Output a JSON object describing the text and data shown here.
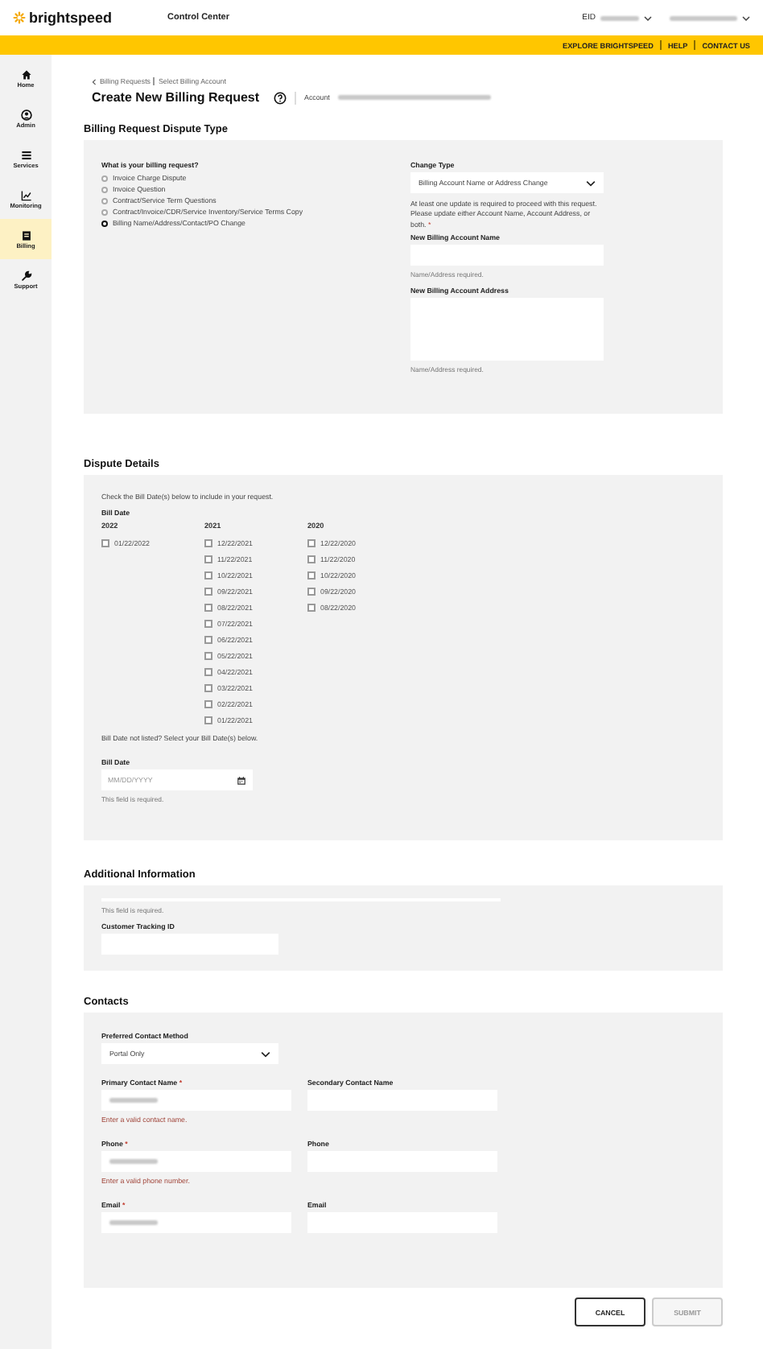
{
  "header": {
    "logo": "brightspeed",
    "app_title": "Control Center",
    "eid_label": "EID"
  },
  "utility_links": [
    "EXPLORE BRIGHTSPEED",
    "HELP",
    "CONTACT US"
  ],
  "sidebar": [
    {
      "label": "Home",
      "kind": "home",
      "selected": false
    },
    {
      "label": "Admin",
      "kind": "user",
      "selected": false
    },
    {
      "label": "Services",
      "kind": "list",
      "selected": false
    },
    {
      "label": "Monitoring",
      "kind": "chart",
      "selected": false
    },
    {
      "label": "Billing",
      "kind": "bill",
      "selected": true
    },
    {
      "label": "Support",
      "kind": "wrench",
      "selected": false
    }
  ],
  "breadcrumb": [
    "Billing Requests",
    "Select Billing Account"
  ],
  "title": "Create New Billing Request",
  "account_label": "Account",
  "dispute_type": {
    "heading": "Billing Request Dispute Type",
    "question": "What is your billing request?",
    "options": [
      {
        "label": "Invoice Charge Dispute",
        "selected": false
      },
      {
        "label": "Invoice Question",
        "selected": false
      },
      {
        "label": "Contract/Service Term Questions",
        "selected": false
      },
      {
        "label": "Contract/Invoice/CDR/Service Inventory/Service Terms Copy",
        "selected": false
      },
      {
        "label": "Billing Name/Address/Contact/PO Change",
        "selected": true
      }
    ],
    "change_type": {
      "label": "Change Type",
      "value": "Billing Account Name or Address Change"
    },
    "notice": "At least one update is required to proceed with this request. Please update either Account Name, Account Address, or both.",
    "required_mark": "*",
    "name_field": {
      "label": "New Billing Account Name",
      "hint": "Name/Address required."
    },
    "address_field": {
      "label": "New Billing Account Address",
      "hint": "Name/Address required."
    }
  },
  "dispute_details": {
    "heading": "Dispute Details",
    "instruction": "Check the Bill Date(s) below to include in your request.",
    "bill_date_label": "Bill Date",
    "years": [
      {
        "year": "2022",
        "dates": [
          {
            "date": "01/22/2022",
            "checked": false
          }
        ]
      },
      {
        "year": "2021",
        "dates": [
          {
            "date": "12/22/2021",
            "checked": false
          },
          {
            "date": "11/22/2021",
            "checked": false
          },
          {
            "date": "10/22/2021",
            "checked": false
          },
          {
            "date": "09/22/2021",
            "checked": false
          },
          {
            "date": "08/22/2021",
            "checked": false
          },
          {
            "date": "07/22/2021",
            "checked": false
          },
          {
            "date": "06/22/2021",
            "checked": false
          },
          {
            "date": "05/22/2021",
            "checked": false
          },
          {
            "date": "04/22/2021",
            "checked": false
          },
          {
            "date": "03/22/2021",
            "checked": false
          },
          {
            "date": "02/22/2021",
            "checked": false
          },
          {
            "date": "01/22/2021",
            "checked": false
          }
        ]
      },
      {
        "year": "2020",
        "dates": [
          {
            "date": "12/22/2020",
            "checked": false
          },
          {
            "date": "11/22/2020",
            "checked": false
          },
          {
            "date": "10/22/2020",
            "checked": false
          },
          {
            "date": "09/22/2020",
            "checked": false
          },
          {
            "date": "08/22/2020",
            "checked": false
          }
        ]
      }
    ],
    "not_listed": "Bill Date not listed? Select your Bill Date(s) below.",
    "date_field": {
      "label": "Bill Date",
      "placeholder": "MM/DD/YYYY",
      "hint": "This field is required."
    }
  },
  "additional_information": {
    "heading": "Additional Information",
    "hint": "This field is required.",
    "tracking_label": "Customer Tracking ID"
  },
  "contacts": {
    "heading": "Contacts",
    "method": {
      "label": "Preferred Contact Method",
      "value": "Portal Only"
    },
    "rows": [
      {
        "primary": {
          "label": "Primary Contact Name",
          "required_mark": "*",
          "redacted": true,
          "error": "Enter a valid contact name."
        },
        "secondary": {
          "label": "Secondary Contact Name"
        }
      },
      {
        "primary": {
          "label": "Phone",
          "required_mark": "*",
          "redacted": true,
          "error": "Enter a valid phone number."
        },
        "secondary": {
          "label": "Phone"
        }
      },
      {
        "primary": {
          "label": "Email",
          "required_mark": "*",
          "redacted": true
        },
        "secondary": {
          "label": "Email"
        }
      }
    ]
  },
  "buttons": [
    {
      "label": "CANCEL",
      "disabled": false
    },
    {
      "label": "SUBMIT",
      "disabled": true
    }
  ]
}
